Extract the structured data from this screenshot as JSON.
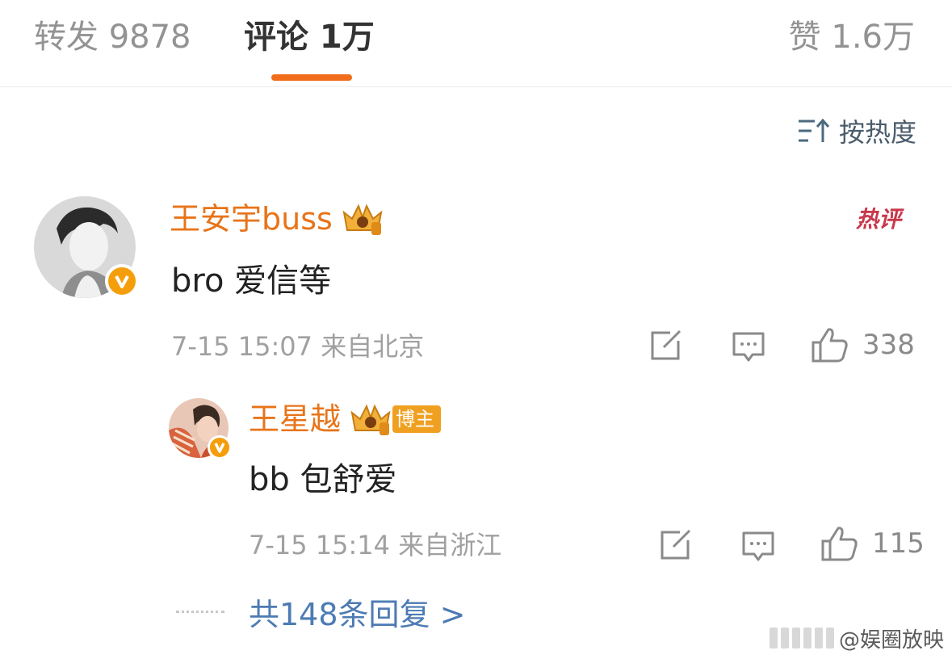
{
  "tabs": {
    "repost": "转发 9878",
    "comments": "评论 1万",
    "likes": "赞 1.6万"
  },
  "sort": {
    "label": "按热度",
    "icon": "sort-icon"
  },
  "comment": {
    "author": "王安宇buss",
    "hot_tag": "热评",
    "text": "bro 爱信等",
    "meta": "7-15 15:07 来自北京",
    "like_count": "338",
    "reply": {
      "author": "王星越",
      "blogger_badge": "博主",
      "text": "bb 包舒爱",
      "meta": "7-15 15:14 来自浙江",
      "like_count": "115"
    },
    "reply_link": "共148条回复 >"
  },
  "watermark": "@娱圈放映",
  "colors": {
    "accent": "#f26d1b",
    "username": "#e8741a",
    "link": "#4d7bb3",
    "hot": "#c9374a",
    "verified": "#f59e0b"
  }
}
